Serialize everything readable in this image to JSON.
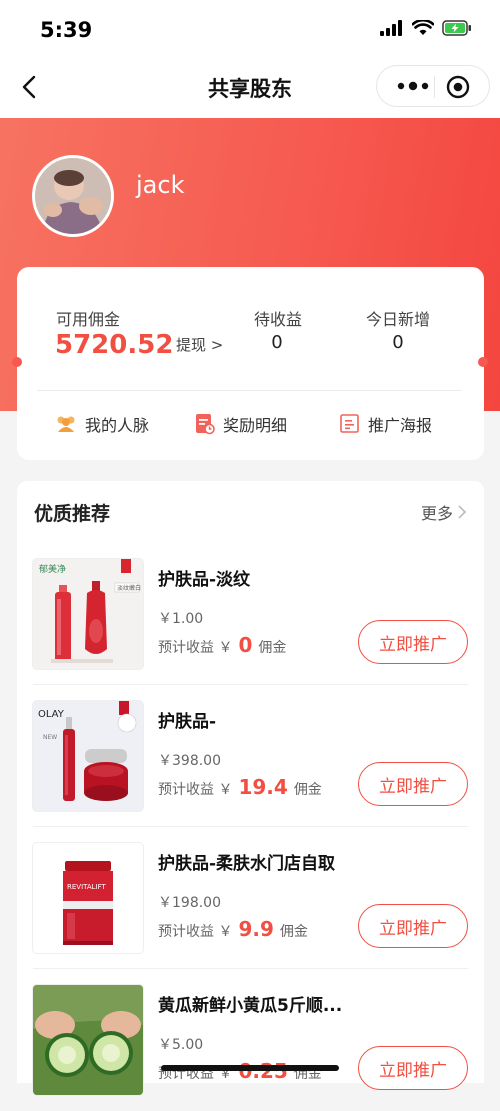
{
  "status": {
    "time": "5:39"
  },
  "nav": {
    "title": "共享股东"
  },
  "profile": {
    "username": "jack"
  },
  "earnings": {
    "available_label": "可用佣金",
    "available_value": "5720.52",
    "withdraw_label": "提现 >",
    "pending_label": "待收益",
    "pending_value": "0",
    "today_label": "今日新增",
    "today_value": "0"
  },
  "links": [
    {
      "label": "我的人脉",
      "icon": "people-icon"
    },
    {
      "label": "奖励明细",
      "icon": "reward-detail-icon"
    },
    {
      "label": "推广海报",
      "icon": "poster-icon"
    }
  ],
  "recommend": {
    "title": "优质推荐",
    "more_label": "更多"
  },
  "products": [
    {
      "name": "护肤品-淡纹",
      "price": "￥1.00",
      "earn_label": "预计收益 ￥",
      "earn_amount": "0",
      "earn_unit": "佣金",
      "button": "立即推广"
    },
    {
      "name": "护肤品-",
      "price": "￥398.00",
      "earn_label": "预计收益 ￥",
      "earn_amount": "19.4",
      "earn_unit": "佣金",
      "button": "立即推广"
    },
    {
      "name": "护肤品-柔肤水门店自取",
      "price": "￥198.00",
      "earn_label": "预计收益 ￥",
      "earn_amount": "9.9",
      "earn_unit": "佣金",
      "button": "立即推广"
    },
    {
      "name": "黄瓜新鲜小黄瓜5斤顺...",
      "price": "￥5.00",
      "earn_label": "预计收益 ￥",
      "earn_amount": "0.25",
      "earn_unit": "佣金",
      "button": "立即推广"
    }
  ],
  "thumb_text": {
    "brand_1": "郁美净",
    "tag_1": "淡纹嫩白",
    "brand_2": "OLAY",
    "sub_2": "NEW",
    "brand_3": "REVITALIFT"
  },
  "colors": {
    "accent": "#f04f42",
    "hero_start": "#f77361",
    "hero_end": "#f3463f"
  }
}
